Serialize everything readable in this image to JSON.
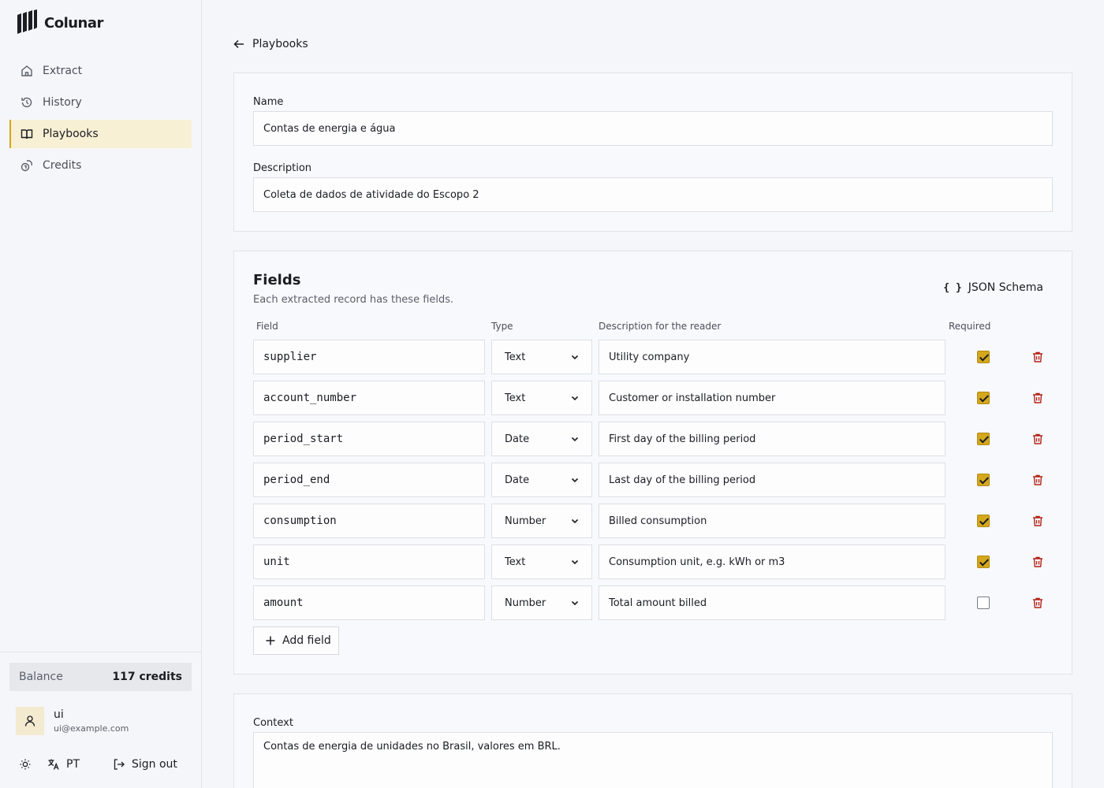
{
  "brand": {
    "name": "Colunar"
  },
  "nav": {
    "items": [
      {
        "label": "Extract",
        "icon": "home-icon"
      },
      {
        "label": "History",
        "icon": "history-icon"
      },
      {
        "label": "Playbooks",
        "icon": "book-icon",
        "active": true
      },
      {
        "label": "Credits",
        "icon": "coins-icon"
      }
    ]
  },
  "balance": {
    "label": "Balance",
    "value": "117 credits"
  },
  "user": {
    "name": "ui",
    "email": "ui@example.com"
  },
  "footer": {
    "language": "PT",
    "sign_out": "Sign out"
  },
  "back": {
    "label": "Playbooks"
  },
  "playbook": {
    "name_label": "Name",
    "name_value": "Contas de energia e água",
    "description_label": "Description",
    "description_value": "Coleta de dados de atividade do Escopo 2"
  },
  "fields": {
    "title": "Fields",
    "subtitle": "Each extracted record has these fields.",
    "json_schema_label": "JSON Schema",
    "headers": {
      "field": "Field",
      "type": "Type",
      "description": "Description for the reader",
      "required": "Required"
    },
    "rows": [
      {
        "name": "supplier",
        "type": "Text",
        "description": "Utility company",
        "required": true
      },
      {
        "name": "account_number",
        "type": "Text",
        "description": "Customer or installation number",
        "required": true
      },
      {
        "name": "period_start",
        "type": "Date",
        "description": "First day of the billing period",
        "required": true
      },
      {
        "name": "period_end",
        "type": "Date",
        "description": "Last day of the billing period",
        "required": true
      },
      {
        "name": "consumption",
        "type": "Number",
        "description": "Billed consumption",
        "required": true
      },
      {
        "name": "unit",
        "type": "Text",
        "description": "Consumption unit, e.g. kWh or m3",
        "required": true
      },
      {
        "name": "amount",
        "type": "Number",
        "description": "Total amount billed",
        "required": false
      }
    ],
    "add_label": "Add field"
  },
  "context": {
    "label": "Context",
    "value": "Contas de energia de unidades no Brasil, valores em BRL."
  },
  "colors": {
    "accent": "#d4a71c",
    "active_bg": "#f8f0d4",
    "danger": "#b42318"
  }
}
